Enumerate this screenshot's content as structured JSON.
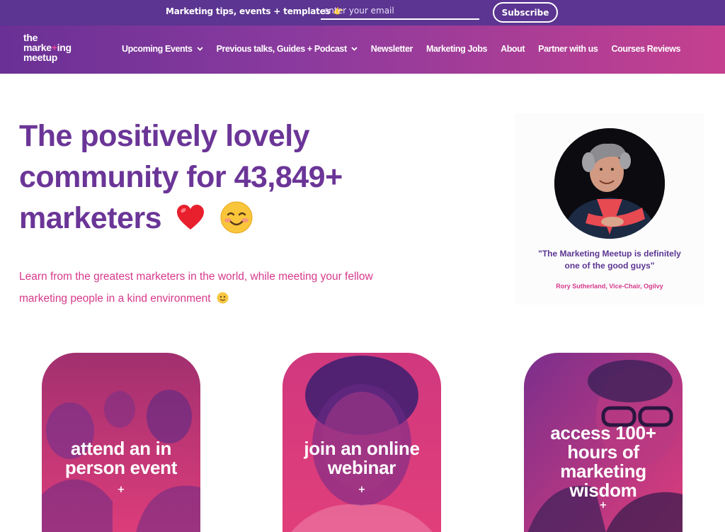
{
  "signup": {
    "text": "Marketing tips, events + templates 👉",
    "email_placeholder": "enter your email",
    "subscribe_label": "Subscribe"
  },
  "logo": {
    "line1": "the",
    "line2a": "marke",
    "line2b": "ing",
    "line2_plus": "+",
    "line3": "meetup"
  },
  "nav": {
    "items": [
      {
        "label": "Upcoming Events",
        "has_dropdown": true
      },
      {
        "label": "Previous talks, Guides + Podcast",
        "has_dropdown": true
      },
      {
        "label": "Newsletter",
        "has_dropdown": false
      },
      {
        "label": "Marketing Jobs",
        "has_dropdown": false
      },
      {
        "label": "About",
        "has_dropdown": false
      },
      {
        "label": "Partner with us",
        "has_dropdown": false
      },
      {
        "label": "Courses Reviews",
        "has_dropdown": false
      }
    ]
  },
  "hero": {
    "title_line1": "The positively lovely",
    "title_line2": "community for 43,849+",
    "title_line3": "marketers",
    "subtitle_line1": "Learn from the greatest marketers in the world, while meeting your fellow",
    "subtitle_line2": "marketing people in a kind environment"
  },
  "testimonial": {
    "quote_line1": "\"The Marketing Meetup is definitely",
    "quote_line2": "one of the good guys\"",
    "author": "Rory Sutherland, Vice-Chair, Ogilvy"
  },
  "cards": [
    {
      "label_line1": "attend an in",
      "label_line2": "person event",
      "plus": "+"
    },
    {
      "label_line1": "join an online",
      "label_line2": "webinar",
      "plus": "+"
    },
    {
      "label_line1": "access 100+",
      "label_line2": "hours of",
      "label_line3": "marketing",
      "label_line4": "wisdom",
      "plus": "+"
    }
  ],
  "colors": {
    "topbar": "#5b3591",
    "nav_gradient_start": "#6a3095",
    "nav_gradient_end": "#c5408f",
    "title_purple": "#6b3597",
    "accent_pink": "#d6398b"
  },
  "icons": {
    "nav_dropdown": "chevron-down-icon",
    "heart": "red-heart-emoji",
    "smile": "smiling-face-emoji"
  }
}
